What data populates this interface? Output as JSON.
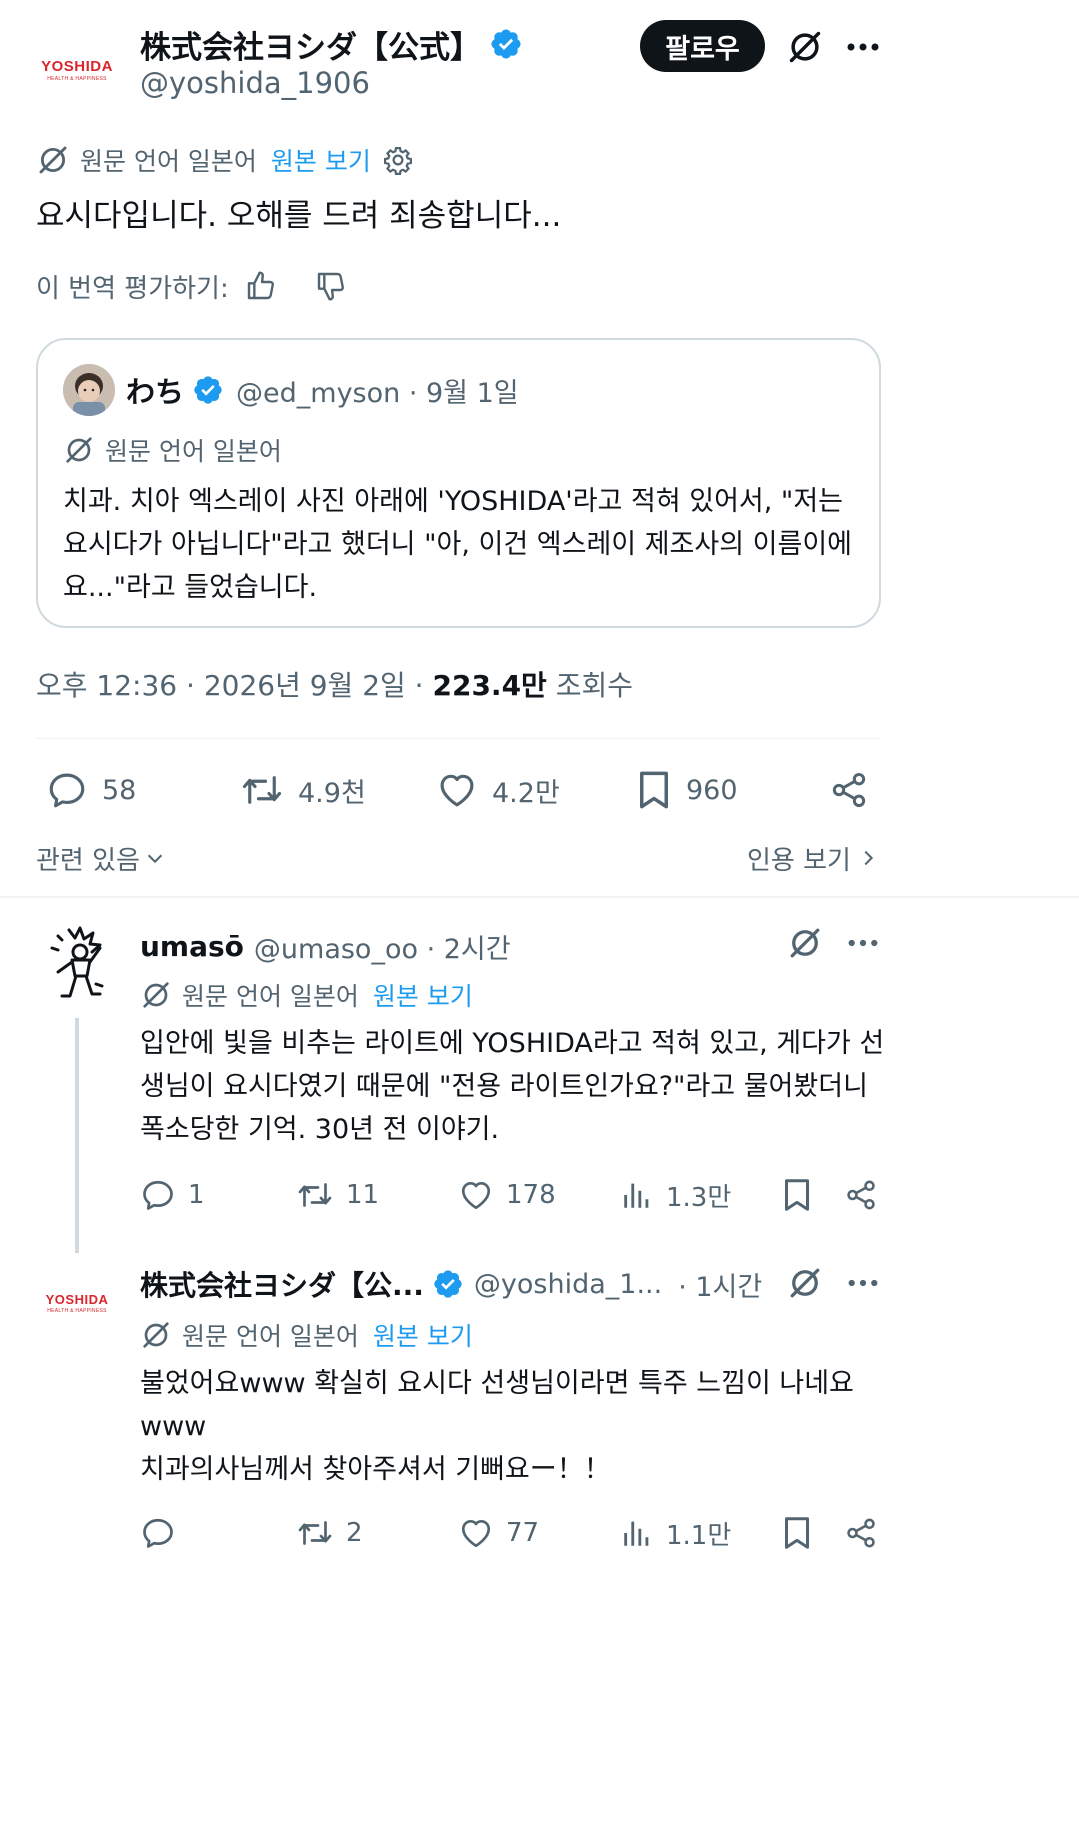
{
  "post": {
    "author_name": "株式会社ヨシダ【公式】",
    "author_handle": "@yoshida_1906",
    "logo_word": "YOSHIDA",
    "logo_sub": "HEALTH & HAPPINESS",
    "follow_label": "팔로우",
    "translation_label": "원문 언어 일본어",
    "view_original": "원본 보기",
    "text": "요시다입니다. 오해를 드려 죄송합니다...",
    "rate_label": "이 번역 평가하기:",
    "timestamp": "오후 12:36 · 2026년 9월 2일 · ",
    "views_count": "223.4만",
    "views_label": " 조회수",
    "stats": {
      "replies": "58",
      "reposts": "4.9천",
      "likes": "4.2만",
      "bookmarks": "960"
    },
    "related_label": "관련 있음",
    "quotes_label": "인용 보기"
  },
  "quoted": {
    "name": "わち",
    "handle_date": "@ed_myson · 9월 1일",
    "translation_label": "원문 언어 일본어",
    "text": "치과. 치아 엑스레이 사진 아래에 'YOSHIDA'라고 적혀 있어서, \"저는 요시다가 아닙니다\"라고 했더니 \"아, 이건 엑스레이 제조사의 이름이에요...\"라고 들었습니다."
  },
  "replies": [
    {
      "name": "umasō",
      "handle_time": "@umaso_oo · 2시간",
      "translation_label": "원문 언어 일본어",
      "view_original": "원본 보기",
      "text": "입안에 빛을 비추는 라이트에 YOSHIDA라고 적혀 있고, 게다가 선생님이 요시다였기 때문에 \"전용 라이트인가요?\"라고 물어봤더니 폭소당한 기억. 30년 전 이야기.",
      "stats": {
        "replies": "1",
        "reposts": "11",
        "likes": "178",
        "views": "1.3만"
      }
    },
    {
      "name": "株式会社ヨシダ【公...",
      "handle": "@yoshida_1...",
      "time": "· 1시간",
      "translation_label": "원문 언어 일본어",
      "view_original": "원본 보기",
      "text_line1": "불었어요www 확실히 요시다 선생님이라면 특주 느낌이 나네요www",
      "text_line2": "치과의사님께서 찾아주셔서 기뻐요ー！！",
      "stats": {
        "replies": "",
        "reposts": "2",
        "likes": "77",
        "views": "1.1만"
      }
    }
  ],
  "colors": {
    "text": "#0f1419",
    "muted": "#536471",
    "link": "#1d9bf0",
    "verified": "#1d9bf0",
    "logo_red": "#d9252b",
    "border": "#cfd9de"
  }
}
